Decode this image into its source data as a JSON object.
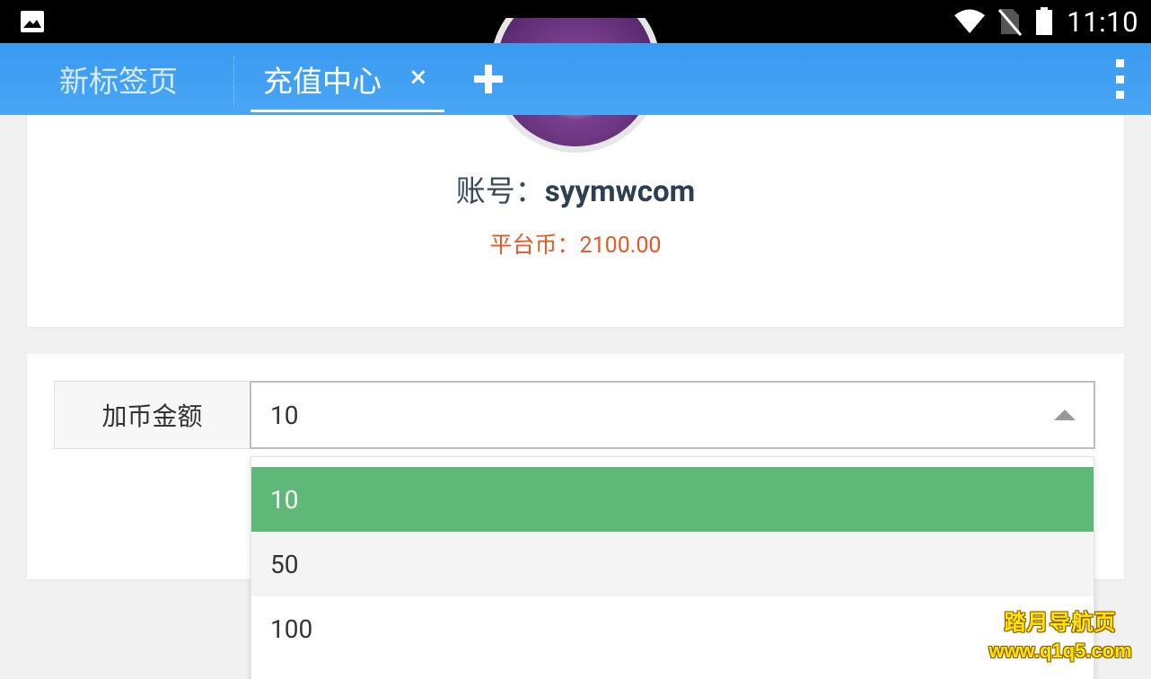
{
  "status_bar": {
    "time": "11:10",
    "icons": [
      "image-notification-icon",
      "wifi-icon",
      "no-sim-icon",
      "battery-icon"
    ]
  },
  "tabs": {
    "inactive_label": "新标签页",
    "active_label": "充值中心",
    "close_glyph": "×",
    "icons": [
      "close-icon",
      "add-tab-icon",
      "more-vert-icon"
    ]
  },
  "profile": {
    "account_label": "账号：",
    "account_value": "syymwcom",
    "coin_label": "平台币：",
    "coin_value": "2100.00",
    "coin_color": "#e05a2b"
  },
  "recharge_form": {
    "field_label": "加币金额",
    "selected_value": "10",
    "options": [
      "10",
      "50",
      "100"
    ],
    "selected_color": "#5fb878"
  },
  "watermark": {
    "line1": "踏月导航页",
    "line2": "www.q1q5.com"
  },
  "colors": {
    "tab_bar": "#3a9af1",
    "selected_option": "#5fb878",
    "coin_text": "#e05a2b"
  }
}
